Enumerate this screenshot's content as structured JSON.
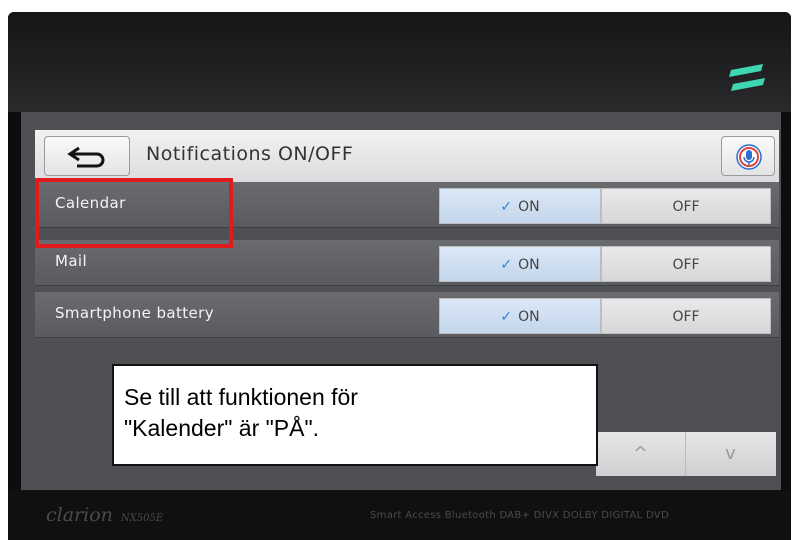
{
  "header": {
    "title": "Notifications ON/OFF",
    "back_icon": "back-arrow-icon",
    "mic_icon": "microphone-icon"
  },
  "rows": [
    {
      "label": "Calendar",
      "on_label": "ON",
      "off_label": "OFF",
      "state": "on"
    },
    {
      "label": "Mail",
      "on_label": "ON",
      "off_label": "OFF",
      "state": "on"
    },
    {
      "label": "Smartphone battery",
      "on_label": "ON",
      "off_label": "OFF",
      "state": "on"
    }
  ],
  "nav": {
    "up": "^",
    "down": "v"
  },
  "device": {
    "brand": "clarion",
    "model": "NX505E",
    "logos": "Smart Access  Bluetooth  DAB+  DIVX  DOLBY DIGITAL  DVD"
  },
  "annotation": {
    "text_line1": "Se till att funktionen för",
    "text_line2": "\"Kalender\" är \"PÅ\"."
  },
  "colors": {
    "highlight": "#e11b1b",
    "check": "#2b82d9",
    "screen_bg": "#4f5053"
  }
}
